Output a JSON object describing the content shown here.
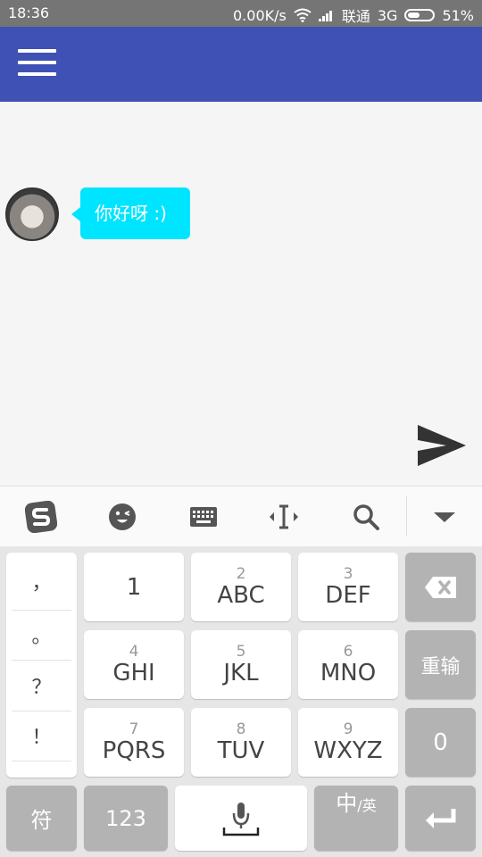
{
  "status_bar": {
    "time": "18:36",
    "network_speed": "0.00K/s",
    "carrier": "联通",
    "network_type": "3G",
    "battery_percent": "51%",
    "battery_level": 0.51,
    "icons": [
      "wifi-icon",
      "signal-icon",
      "battery-icon"
    ]
  },
  "app_bar": {
    "color": "#3f51b5",
    "menu_icon": "hamburger-menu-icon"
  },
  "chat": {
    "messages": [
      {
        "text": "你好呀 :)",
        "bubble_color": "#00e5ff"
      }
    ],
    "send_icon": "send-icon"
  },
  "keyboard_toolbar": {
    "icons": [
      "sogou-logo-icon",
      "emoji-icon",
      "keyboard-icon",
      "cursor-move-icon",
      "search-icon",
      "collapse-keyboard-icon"
    ]
  },
  "keyboard": {
    "punctuation": [
      "，",
      "。",
      "？",
      "！"
    ],
    "keys": [
      {
        "num": "",
        "letters": "1"
      },
      {
        "num": "2",
        "letters": "ABC"
      },
      {
        "num": "3",
        "letters": "DEF"
      },
      {
        "num": "4",
        "letters": "GHI"
      },
      {
        "num": "5",
        "letters": "JKL"
      },
      {
        "num": "6",
        "letters": "MNO"
      },
      {
        "num": "7",
        "letters": "PQRS"
      },
      {
        "num": "8",
        "letters": "TUV"
      },
      {
        "num": "9",
        "letters": "WXYZ"
      }
    ],
    "reset_label": "重输",
    "zero_label": "0",
    "symbol_label": "符",
    "num123_label": "123",
    "lang_main": "中",
    "lang_sub": "/英",
    "icons": [
      "backspace-icon",
      "microphone-icon",
      "enter-icon"
    ]
  }
}
